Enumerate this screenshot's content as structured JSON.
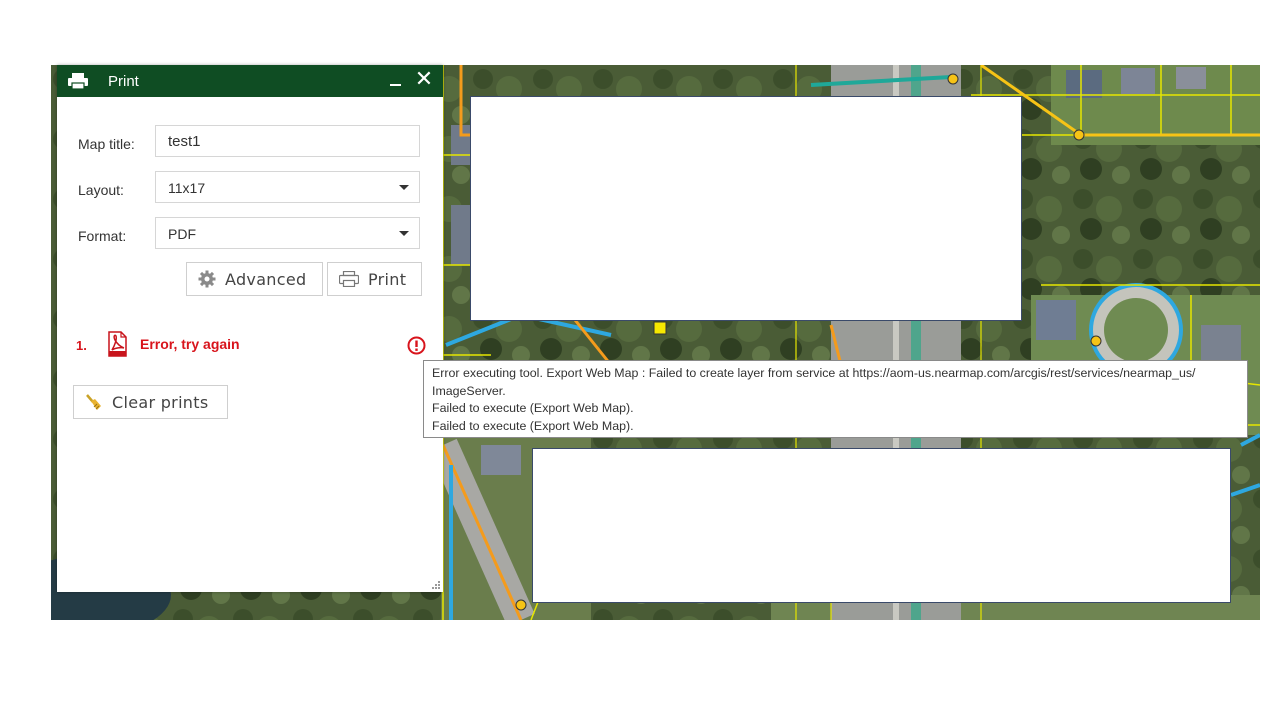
{
  "panel": {
    "title": "Print",
    "close_glyph": "✕",
    "icons": {
      "header": "printer-icon",
      "minimize": "minimize-icon",
      "close": "close-icon"
    }
  },
  "form": {
    "map_title_label": "Map title:",
    "map_title_value": "test1",
    "layout_label": "Layout:",
    "layout_value": "11x17",
    "format_label": "Format:",
    "format_value": "PDF"
  },
  "buttons": {
    "advanced_label": "Advanced",
    "print_label": "Print",
    "clear_label": "Clear prints"
  },
  "results": [
    {
      "index": "1.",
      "status": "Error, try again",
      "file_icon": "pdf-icon",
      "status_icon": "error-icon"
    }
  ],
  "tooltip": {
    "line1": "Error executing tool. Export Web Map : Failed to create layer from service at https://aom-us.nearmap.com/arcgis/rest/services/nearmap_us/",
    "line2": "ImageServer.",
    "line3": "Failed to execute (Export Web Map).",
    "line4": "Failed to execute (Export Web Map)."
  },
  "colors": {
    "header_bg": "#0f4d23",
    "error_text": "#d8141c"
  }
}
